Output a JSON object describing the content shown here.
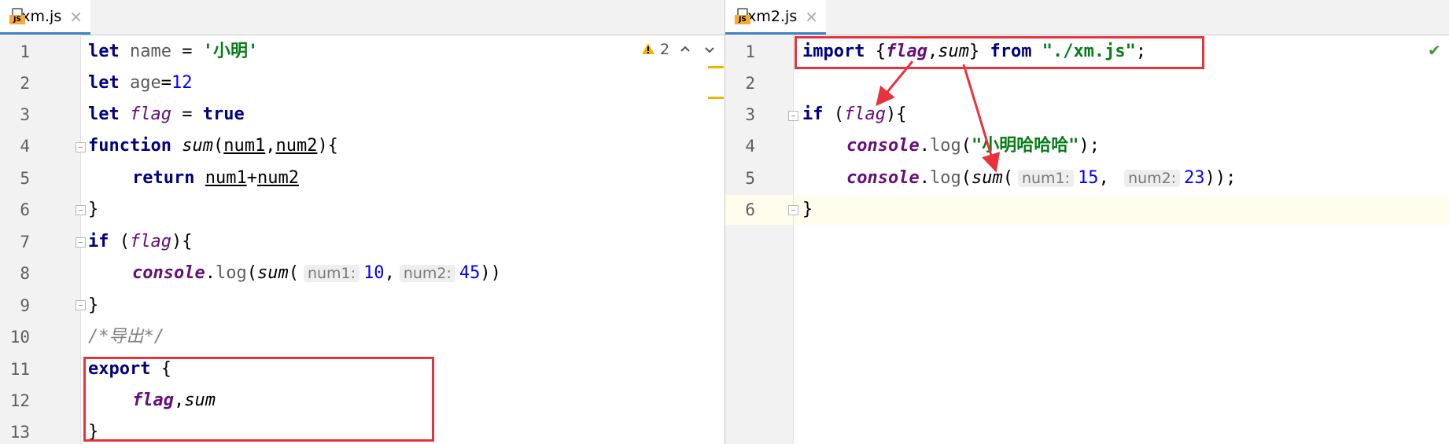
{
  "left": {
    "tab_label": "xm.js",
    "js_badge": "JS",
    "close_glyph": "×",
    "warning_count": "2",
    "lines": [
      "1",
      "2",
      "3",
      "4",
      "5",
      "6",
      "7",
      "8",
      "9",
      "10",
      "11",
      "12",
      "13"
    ],
    "code": {
      "l1_kw": "let",
      "l1_var": "name",
      "l1_eq": " = ",
      "l1_str": "'小明'",
      "l2_kw": "let",
      "l2_var": "age",
      "l2_eq": "=",
      "l2_num": "12",
      "l3_kw": "let",
      "l3_var": "flag",
      "l3_eq": " = ",
      "l3_val": "true",
      "l4_kw": "function",
      "l4_name": "sum",
      "l4_open": "(",
      "l4_p1": "num1",
      "l4_comma": ",",
      "l4_p2": "num2",
      "l4_close": "){",
      "l5_kw": "return",
      "l5_p1": "num1",
      "l5_plus": "+",
      "l5_p2": "num2",
      "l6": "}",
      "l7_kw": "if",
      "l7_open": " (",
      "l7_var": "flag",
      "l7_close": "){",
      "l8_obj": "console",
      "l8_dot": ".",
      "l8_log": "log",
      "l8_open": "(",
      "l8_fn": "sum",
      "l8_paren": "(",
      "l8_hint1": "num1:",
      "l8_v1": "10",
      "l8_comma": ",",
      "l8_hint2": "num2:",
      "l8_v2": "45",
      "l8_close": "))",
      "l9": "}",
      "l10": "/*导出*/",
      "l11_kw": "export",
      "l11_brace": " {",
      "l12_a": "flag",
      "l12_comma": ",",
      "l12_b": "sum",
      "l13": "}"
    }
  },
  "right": {
    "tab_label": "xm2.js",
    "js_badge": "JS",
    "close_glyph": "×",
    "check_glyph": "✔",
    "lines": [
      "1",
      "2",
      "3",
      "4",
      "5",
      "6"
    ],
    "code": {
      "l1_kw": "import",
      "l1_open": " {",
      "l1_a": "flag",
      "l1_comma": ",",
      "l1_b": "sum",
      "l1_close": "} ",
      "l1_from": "from",
      "l1_str": "\"./xm.js\"",
      "l1_semi": ";",
      "l3_kw": "if",
      "l3_open": " (",
      "l3_var": "flag",
      "l3_close": "){",
      "l4_obj": "console",
      "l4_dot": ".",
      "l4_log": "log",
      "l4_open": "(",
      "l4_str": "\"小明哈哈哈\"",
      "l4_close": ");",
      "l5_obj": "console",
      "l5_dot": ".",
      "l5_log": "log",
      "l5_open": "(",
      "l5_fn": "sum",
      "l5_paren": "(",
      "l5_hint1": "num1:",
      "l5_v1": "15",
      "l5_comma": ",",
      "l5_hint2": "num2:",
      "l5_v2": "23",
      "l5_close": "));",
      "l6": "}"
    }
  },
  "colors": {
    "keyword": "#000080",
    "string": "#067d17",
    "number": "#0000ff",
    "global_var": "#660e7a",
    "annotation_red": "#e8323c",
    "caret_row": "#fffdec"
  }
}
